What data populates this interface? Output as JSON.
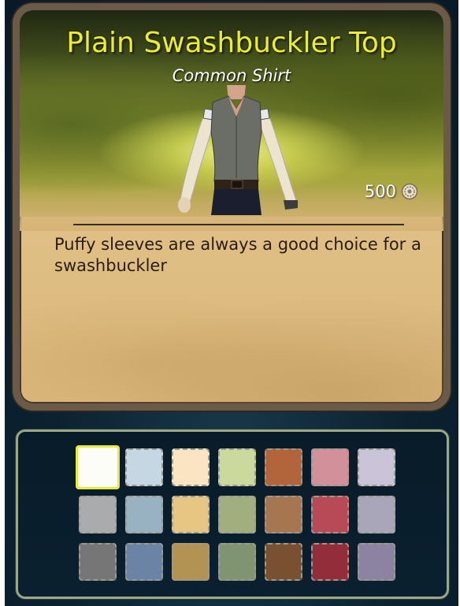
{
  "item": {
    "name": "Plain Swashbuckler Top",
    "rarity_type": "Common Shirt",
    "price": "500",
    "price_icon": "coin-icon",
    "description": "Puffy sleeves are always a good choice for a swashbuckler",
    "preview_icon": "shirt-preview-image"
  },
  "colors": {
    "title": "#e8f02a",
    "selected_outline": "#e7ea3a"
  },
  "palette": {
    "selected_index": 0,
    "swatches": [
      {
        "name": "white",
        "color": "#fdfdf7"
      },
      {
        "name": "light-blue",
        "color": "#c6d7e4"
      },
      {
        "name": "light-peach",
        "color": "#fbe4c2"
      },
      {
        "name": "light-green",
        "color": "#ccd99c"
      },
      {
        "name": "rust",
        "color": "#b2643a"
      },
      {
        "name": "dusty-pink",
        "color": "#d1909a"
      },
      {
        "name": "lavender",
        "color": "#cbc3d8"
      },
      {
        "name": "light-gray",
        "color": "#a9abac"
      },
      {
        "name": "steel-blue",
        "color": "#98b2c1"
      },
      {
        "name": "tan",
        "color": "#e7c582"
      },
      {
        "name": "sage",
        "color": "#a1ae7e"
      },
      {
        "name": "brown",
        "color": "#a57650"
      },
      {
        "name": "crimson",
        "color": "#b84956"
      },
      {
        "name": "gray-lilac",
        "color": "#a8a6b8"
      },
      {
        "name": "dark-gray",
        "color": "#757675"
      },
      {
        "name": "slate-blue",
        "color": "#6b84a6"
      },
      {
        "name": "ochre",
        "color": "#b39354"
      },
      {
        "name": "olive-green",
        "color": "#809472"
      },
      {
        "name": "dark-brown",
        "color": "#7a5130"
      },
      {
        "name": "maroon",
        "color": "#942d3a"
      },
      {
        "name": "purple-gray",
        "color": "#8c83a2"
      }
    ]
  }
}
